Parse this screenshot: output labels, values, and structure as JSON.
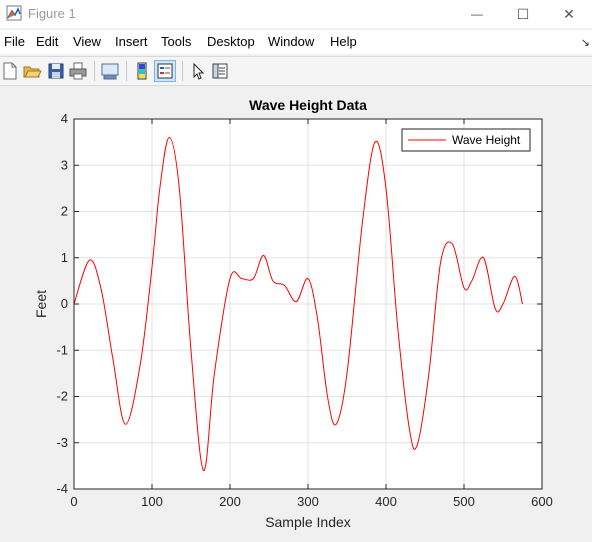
{
  "window": {
    "title": "Figure 1",
    "minimize_glyph": "—",
    "maximize_glyph": "☐",
    "close_glyph": "✕"
  },
  "menu": [
    "File",
    "Edit",
    "View",
    "Insert",
    "Tools",
    "Desktop",
    "Window",
    "Help"
  ],
  "menu_dock_glyph": "↘",
  "toolbar": {
    "icons": [
      "new-figure-icon",
      "open-file-icon",
      "save-icon",
      "print-icon",
      "link-plot-icon",
      "insert-colorbar-icon",
      "insert-legend-icon",
      "edit-plot-pointer-icon",
      "property-inspector-icon"
    ]
  },
  "colors": {
    "line": "#ff0000",
    "axes_bg": "#ffffff",
    "figure_bg": "#f0f0f0",
    "grid": "#e3e3e3"
  },
  "chart_data": {
    "type": "line",
    "title": "Wave Height Data",
    "xlabel": "Sample Index",
    "ylabel": "Feet",
    "xlim": [
      0,
      600
    ],
    "ylim": [
      -4,
      4
    ],
    "xticks": [
      "0",
      "100",
      "200",
      "300",
      "400",
      "500",
      "600"
    ],
    "yticks": [
      "-4",
      "-3",
      "-2",
      "-1",
      "0",
      "1",
      "2",
      "3",
      "4"
    ],
    "grid": true,
    "legend_position": "top-right",
    "series": [
      {
        "name": "Wave Height",
        "color": "#ff0000",
        "x": [
          0,
          20,
          35,
          50,
          66,
          85,
          100,
          110,
          122,
          135,
          150,
          166,
          180,
          200,
          215,
          230,
          243,
          255,
          270,
          285,
          300,
          312,
          325,
          336,
          350,
          370,
          386,
          400,
          415,
          430,
          440,
          455,
          470,
          485,
          500,
          510,
          525,
          540,
          550,
          565,
          575
        ],
        "y": [
          0,
          0.95,
          0.3,
          -1.2,
          -2.6,
          -1.3,
          0.8,
          2.5,
          3.6,
          2.5,
          -1.0,
          -3.6,
          -1.5,
          0.55,
          0.55,
          0.55,
          1.05,
          0.5,
          0.4,
          0.05,
          0.55,
          -0.3,
          -2.0,
          -2.6,
          -1.5,
          1.8,
          3.5,
          2.5,
          -0.5,
          -2.7,
          -3.05,
          -1.5,
          0.9,
          1.3,
          0.35,
          0.5,
          1.0,
          -0.1,
          0,
          0.6,
          0
        ]
      }
    ]
  }
}
